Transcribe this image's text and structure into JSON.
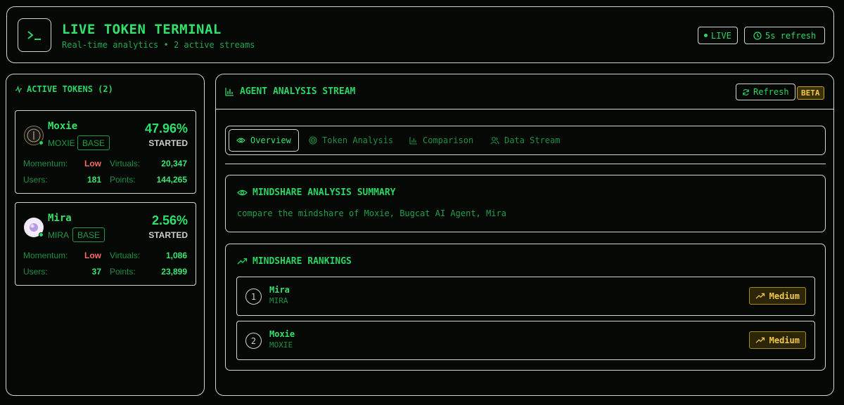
{
  "header": {
    "title": "LIVE TOKEN TERMINAL",
    "subtitle": "Real-time analytics • 2 active streams",
    "live_label": "LIVE",
    "refresh_label": "5s refresh",
    "terminal_icon": "terminal-icon"
  },
  "sidebar": {
    "title": "ACTIVE TOKENS (2)",
    "tokens": [
      {
        "name": "Moxie",
        "symbol": "MOXIE",
        "chain": "BASE",
        "percent": "47.96%",
        "status": "STARTED",
        "momentum_label": "Momentum:",
        "momentum": "Low",
        "virtuals_label": "Virtuals:",
        "virtuals": "20,347",
        "users_label": "Users:",
        "users": "181",
        "points_label": "Points:",
        "points": "144,265"
      },
      {
        "name": "Mira",
        "symbol": "MIRA",
        "chain": "BASE",
        "percent": "2.56%",
        "status": "STARTED",
        "momentum_label": "Momentum:",
        "momentum": "Low",
        "virtuals_label": "Virtuals:",
        "virtuals": "1,086",
        "users_label": "Users:",
        "users": "37",
        "points_label": "Points:",
        "points": "23,899"
      }
    ]
  },
  "main": {
    "title": "AGENT ANALYSIS STREAM",
    "refresh_button": "Refresh",
    "beta_badge": "BETA",
    "tabs": [
      {
        "label": "Overview",
        "icon": "eye-icon"
      },
      {
        "label": "Token Analysis",
        "icon": "target-icon"
      },
      {
        "label": "Comparison",
        "icon": "bar-chart-icon"
      },
      {
        "label": "Data Stream",
        "icon": "users-icon"
      }
    ],
    "summary": {
      "title": "MINDSHARE ANALYSIS SUMMARY",
      "text": "compare the mindshare of Moxie, Bugcat AI Agent, Mira"
    },
    "rankings": {
      "title": "MINDSHARE RANKINGS",
      "items": [
        {
          "rank": "1",
          "name": "Mira",
          "symbol": "MIRA",
          "level": "Medium"
        },
        {
          "rank": "2",
          "name": "Moxie",
          "symbol": "MOXIE",
          "level": "Medium"
        }
      ]
    }
  },
  "colors": {
    "accent": "#2bd463",
    "warning": "#f2c94c",
    "danger": "#ff6b6b",
    "background": "#040604"
  }
}
